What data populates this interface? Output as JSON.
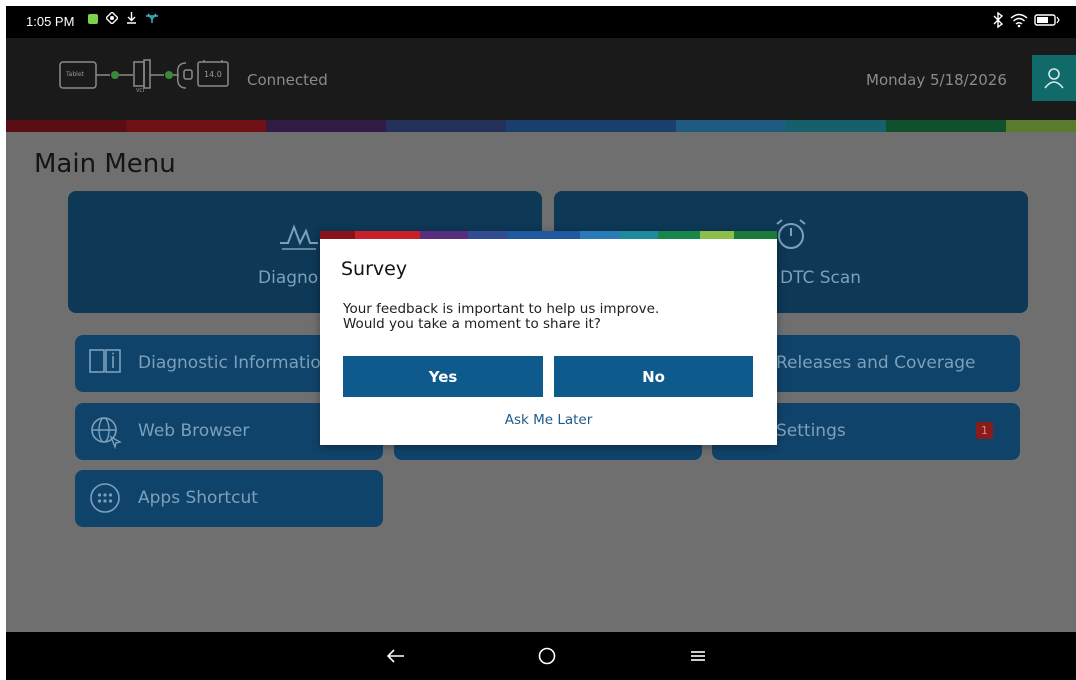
{
  "status_bar": {
    "time": "1:05 PM",
    "left_icons": [
      "notification-app-icon",
      "location-icon",
      "download-icon",
      "cast-icon"
    ],
    "right_icons": [
      "bluetooth-icon",
      "wifi-icon",
      "battery-icon"
    ]
  },
  "header": {
    "vci": {
      "tablet_label": "Tablet",
      "vci_label": "VCI",
      "battery_voltage": "14.0"
    },
    "connection_status": "Connected",
    "date": "Monday 5/18/2026"
  },
  "page": {
    "title": "Main Menu"
  },
  "tiles": {
    "diagnostics": "Diagno",
    "dtc_scan": "DTC Scan",
    "diagnostic_information": "Diagnostic Informatio",
    "releases": "Releases and Coverage",
    "web_browser": "Web Browser",
    "settings": "Settings",
    "settings_badge": "1",
    "apps_shortcut": "Apps Shortcut"
  },
  "dialog": {
    "title": "Survey",
    "message_line1": "Your feedback is important to help us improve.",
    "message_line2": "Would you take a moment to share it?",
    "yes_label": "Yes",
    "no_label": "No",
    "later_label": "Ask Me Later"
  },
  "colors": {
    "brand_rainbow": [
      "#8a1218",
      "#a0131c",
      "#3d1d52",
      "#2a3a6e",
      "#1f4d86",
      "#2b6a9b",
      "#1d7a88",
      "#1a6a3a",
      "#7a9a3a"
    ],
    "dialog_button": "#0f5a8d",
    "tile": "#10436a",
    "user_button": "#106a6a"
  },
  "nav": {
    "icons": [
      "back-arrow-icon",
      "home-circle-icon",
      "menu-icon"
    ]
  }
}
